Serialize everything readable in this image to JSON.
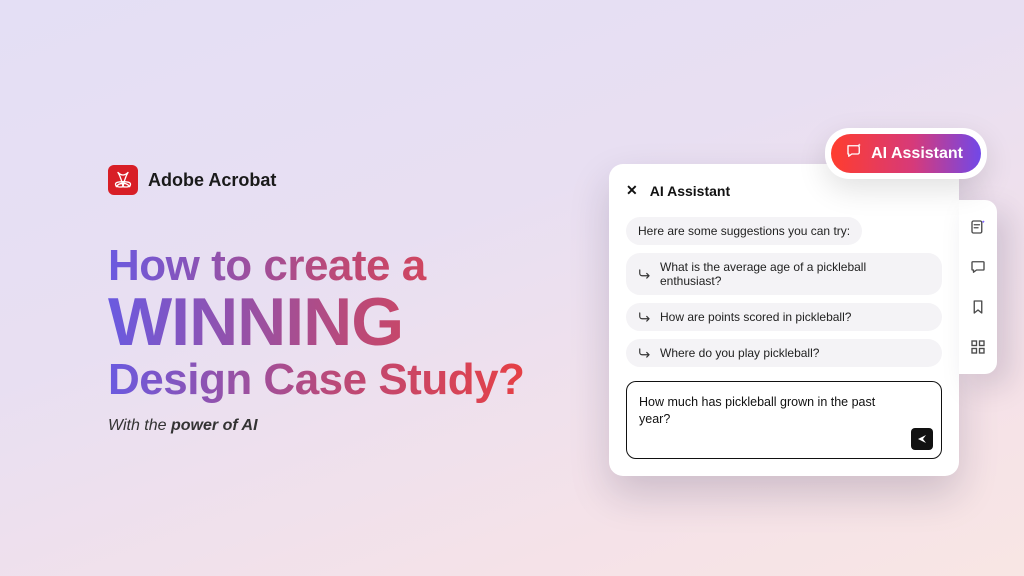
{
  "brand": {
    "name": "Adobe Acrobat"
  },
  "headline": {
    "line1": "How to create a",
    "line2": "WINNING",
    "line3": "Design Case Study?"
  },
  "subtitle": {
    "prefix": "With the ",
    "emphasis": "power of AI"
  },
  "aiPill": {
    "label": "AI Assistant"
  },
  "assistant": {
    "title": "AI Assistant",
    "intro": "Here are some suggestions you can try:",
    "suggestions": [
      "What is the average age of a pickleball enthusiast?",
      "How are points scored in pickleball?",
      "Where do you play pickleball?"
    ],
    "inputText": "How much has pickleball grown in the past year?"
  },
  "toolbar": {
    "items": [
      {
        "name": "note-sparkle-icon"
      },
      {
        "name": "chat-icon"
      },
      {
        "name": "bookmark-icon"
      },
      {
        "name": "grid-icon"
      }
    ]
  }
}
